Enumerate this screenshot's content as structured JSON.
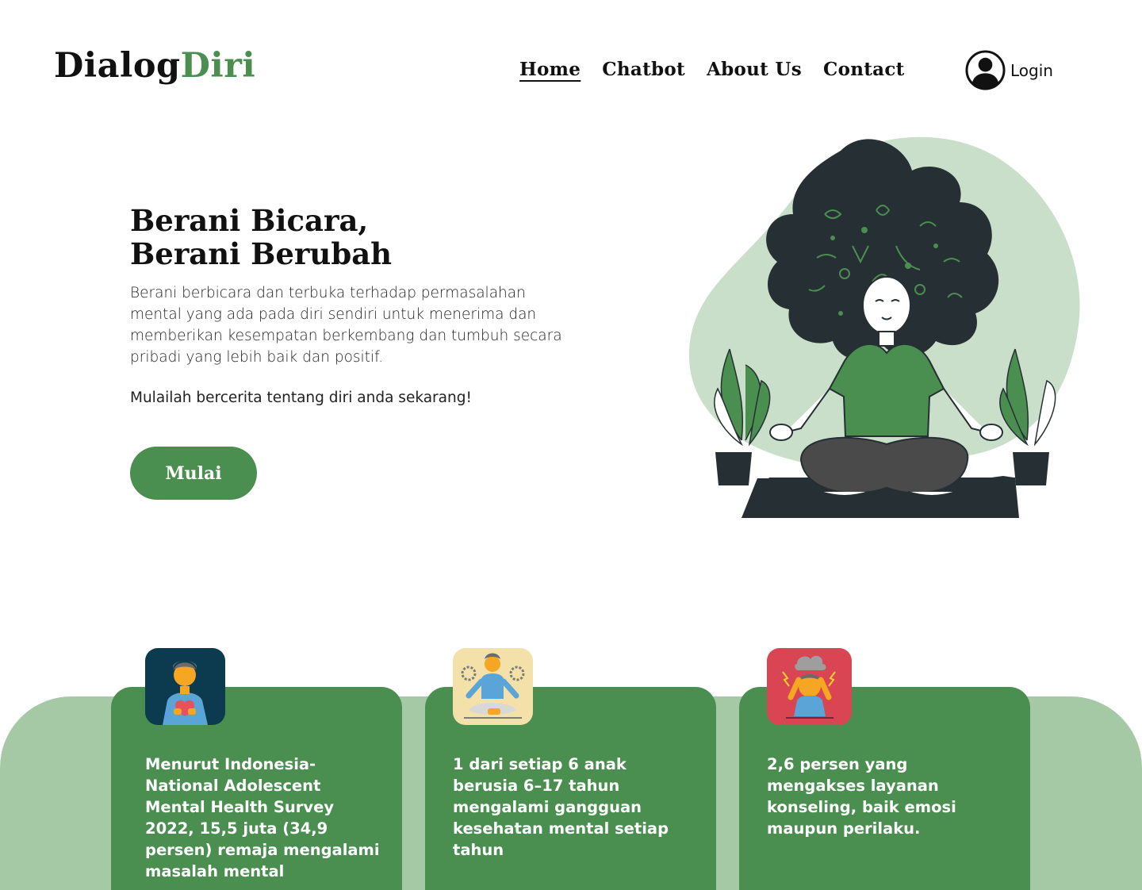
{
  "brand": {
    "part1": "Dialog",
    "part2": "Diri"
  },
  "nav": {
    "home": "Home",
    "chatbot": "Chatbot",
    "about": "About Us",
    "contact": "Contact"
  },
  "login": {
    "label": "Login",
    "icon": "user-circle-icon"
  },
  "hero": {
    "title_line1": "Berani Bicara,",
    "title_line2": "Berani Berubah",
    "description": "Berani berbicara dan terbuka terhadap permasalahan mental yang ada pada diri sendiri untuk menerima  dan memberikan kesempatan berkembang dan tumbuh secara pribadi yang lebih baik dan positif.",
    "cta_text": "Mulailah bercerita tentang diri anda sekarang!",
    "button_label": "Mulai",
    "illustration": "meditating-woman-illustration"
  },
  "stats": [
    {
      "icon": "man-holding-heart-icon",
      "text": "Menurut Indonesia-National Adolescent Mental Health Survey 2022, 15,5 juta (34,9 persen) remaja mengalami masalah mental"
    },
    {
      "icon": "meditating-man-icon",
      "text": "1 dari setiap 6 anak berusia 6–17 tahun mengalami gangguan kesehatan mental setiap tahun"
    },
    {
      "icon": "stressed-person-icon",
      "text": "2,6 persen yang mengakses layanan konseling, baik emosi maupun perilaku."
    }
  ],
  "colors": {
    "brand_green": "#4a8f50",
    "light_green": "#a5c8a5",
    "blob_green": "#c9dfc9",
    "dark": "#262f33"
  }
}
